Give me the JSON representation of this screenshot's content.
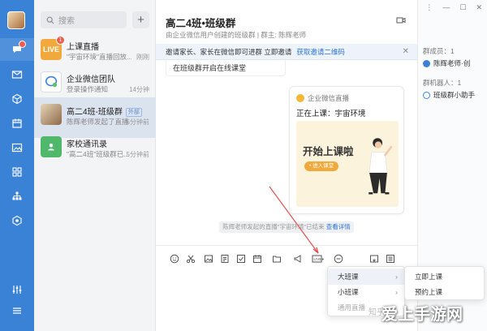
{
  "sidebar": {
    "icons": [
      "message-icon",
      "mail-icon",
      "cube-icon",
      "calendar-icon",
      "image-icon",
      "apps-icon",
      "org-icon",
      "hexagon-icon",
      "settings-icon",
      "menu-icon"
    ]
  },
  "conversation_list": {
    "search_placeholder": "搜索",
    "add_label": "+",
    "items": [
      {
        "name": "上课直播",
        "preview": "\"宇宙环境\"直播回放...",
        "time": "刚刚",
        "avatar_text": "LIVE",
        "badge": "1"
      },
      {
        "name": "企业微信团队",
        "preview": "登录操作通知",
        "time": "14分钟"
      },
      {
        "name": "高二4班-班级群",
        "tag": "外部",
        "preview": "陈辉老师发起了直播",
        "time": "5分钟前"
      },
      {
        "name": "家校通讯录",
        "preview": "\"高二4班\"班级群已...",
        "time": "5分钟前"
      }
    ]
  },
  "chat": {
    "title": "高二4班•班级群",
    "subtitle": "由企业微信用户创建的班级群 | 群主: 陈辉老师",
    "notice_text": "邀请家长、家长在微信即可进群 立即邀请",
    "notice_link": "获取邀请二维码",
    "message_1": "在班级群开启在线课堂",
    "card_source": "企业微信直播",
    "card_title": "正在上课：宇宙环境",
    "poster_text": "开始上课啦",
    "poster_button": "• 进入课堂",
    "system_message": "陈辉老师发起的直播\"宇宙环境\"已结束",
    "system_link": "查看详情"
  },
  "side_panel": {
    "members_label": "群成员：1",
    "member_1": "陈辉老师·创",
    "robots_label": "群机器人：1",
    "robot_1": "班级群小助手"
  },
  "menus": {
    "primary": [
      {
        "label": "大班课",
        "highlight": true
      },
      {
        "label": "小班课"
      },
      {
        "label": "通用直播",
        "dim": true
      }
    ],
    "submenu": [
      {
        "label": "立即上课"
      },
      {
        "label": "预约上课"
      }
    ]
  },
  "watermark": {
    "text": "爱上手游网",
    "secondary": "知乎"
  },
  "colors": {
    "accent": "#3a82d6",
    "badge": "#f25a4a",
    "link": "#2e73d1"
  }
}
